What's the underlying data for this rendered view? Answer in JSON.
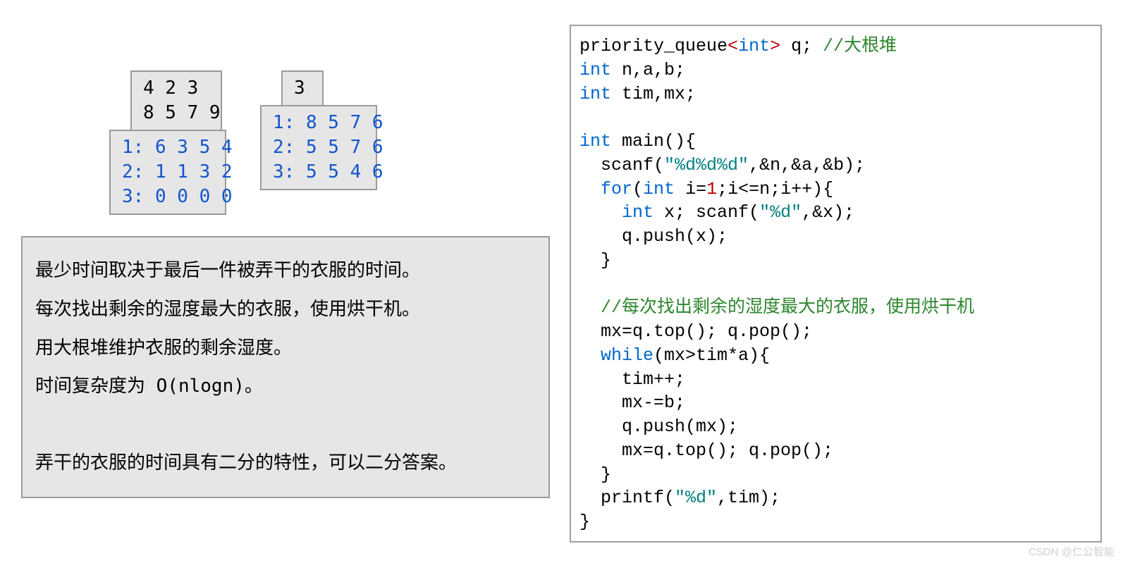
{
  "tables": {
    "left_top": "4 2 3\n8 5 7 9",
    "left_bot": "1: 6 3 5 4\n2: 1 1 3 2\n3: 0 0 0 0",
    "right_top": "3",
    "right_bot": "1: 8 5 7 6\n2: 5 5 7 6\n3: 5 5 4 6"
  },
  "explain": {
    "p1": "最少时间取决于最后一件被弄干的衣服的时间。",
    "p2": "每次找出剩余的湿度最大的衣服，使用烘干机。",
    "p3": "用大根堆维护衣服的剩余湿度。",
    "p4": "时间复杂度为 O(nlogn)。",
    "p5": "弄干的衣服的时间具有二分的特性，可以二分答案。"
  },
  "code": {
    "l01": "priority_queue",
    "l01b": "<",
    "l01c": "int",
    "l01d": ">",
    "l01e": " q; ",
    "l01f": "//大根堆",
    "l02a": "int",
    "l02b": " n,a,b;",
    "l03a": "int",
    "l03b": " tim,mx;",
    "l05a": "int",
    "l05b": " main(){",
    "l06a": "  scanf(",
    "l06b": "\"%d%d%d\"",
    "l06c": ",&n,&a,&b);",
    "l07a": "  ",
    "l07b": "for",
    "l07c": "(",
    "l07d": "int",
    "l07e": " i=",
    "l07f": "1",
    "l07g": ";i<=n;i++){",
    "l08a": "    ",
    "l08b": "int",
    "l08c": " x; scanf(",
    "l08d": "\"%d\"",
    "l08e": ",&x);",
    "l09": "    q.push(x);",
    "l10": "  }",
    "l12": "  //每次找出剩余的湿度最大的衣服，使用烘干机",
    "l13": "  mx=q.top(); q.pop();",
    "l14a": "  ",
    "l14b": "while",
    "l14c": "(mx>tim*a){",
    "l15": "    tim++;",
    "l16": "    mx-=b;",
    "l17": "    q.push(mx);",
    "l18": "    mx=q.top(); q.pop();",
    "l19": "  }",
    "l20a": "  printf(",
    "l20b": "\"%d\"",
    "l20c": ",tim);",
    "l21": "}"
  },
  "watermark": "CSDN @仁公智能"
}
